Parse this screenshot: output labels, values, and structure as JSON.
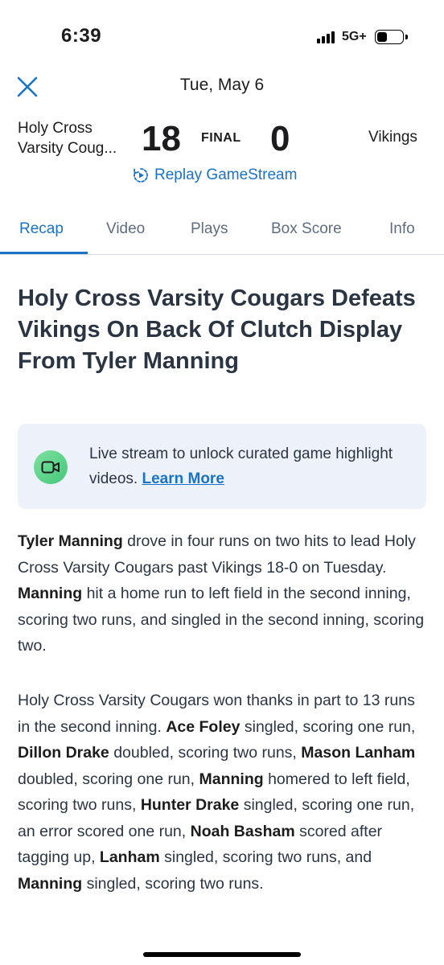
{
  "status_bar": {
    "time": "6:39",
    "network": "5G+"
  },
  "header": {
    "date": "Tue, May 6"
  },
  "game": {
    "home_team_line1": "Holy Cross",
    "home_team_line2": "Varsity Coug...",
    "home_score": "18",
    "status": "FINAL",
    "away_score": "0",
    "away_team": "Vikings",
    "replay_label": "Replay GameStream"
  },
  "tabs": [
    {
      "label": "Recap",
      "active": true
    },
    {
      "label": "Video",
      "active": false
    },
    {
      "label": "Plays",
      "active": false
    },
    {
      "label": "Box Score",
      "active": false
    },
    {
      "label": "Info",
      "active": false
    }
  ],
  "article": {
    "headline": "Holy Cross Varsity Cougars Defeats Vikings On Back Of Clutch Display From Tyler Manning",
    "promo_text": "Live stream to unlock curated game highlight videos.",
    "promo_link": "Learn More",
    "paragraph1": [
      {
        "text": "Tyler Manning",
        "bold": true
      },
      {
        "text": " drove in four runs on two hits to lead Holy Cross Varsity Cougars past Vikings 18-0 on Tuesday. ",
        "bold": false
      },
      {
        "text": "Manning",
        "bold": true
      },
      {
        "text": " hit a home run to left field in the second inning, scoring two runs, and singled in the second inning, scoring two.",
        "bold": false
      }
    ],
    "paragraph2": [
      {
        "text": "Holy Cross Varsity Cougars won thanks in part to 13 runs in the second inning.  ",
        "bold": false
      },
      {
        "text": "Ace  Foley",
        "bold": true
      },
      {
        "text": " singled, scoring one run, ",
        "bold": false
      },
      {
        "text": "Dillon Drake",
        "bold": true
      },
      {
        "text": " doubled, scoring two runs, ",
        "bold": false
      },
      {
        "text": "Mason Lanham",
        "bold": true
      },
      {
        "text": " doubled, scoring one run, ",
        "bold": false
      },
      {
        "text": "Manning",
        "bold": true
      },
      {
        "text": " homered to left field, scoring two runs, ",
        "bold": false
      },
      {
        "text": "Hunter Drake",
        "bold": true
      },
      {
        "text": " singled, scoring one run, an error scored one run, ",
        "bold": false
      },
      {
        "text": "Noah Basham",
        "bold": true
      },
      {
        "text": " scored after tagging up, ",
        "bold": false
      },
      {
        "text": "Lanham",
        "bold": true
      },
      {
        "text": " singled, scoring two runs, and ",
        "bold": false
      },
      {
        "text": "Manning",
        "bold": true
      },
      {
        "text": " singled, scoring two runs.",
        "bold": false
      }
    ]
  },
  "colors": {
    "accent": "#1a73c6",
    "promo_bg": "#edf2fa",
    "text": "#2b3542"
  }
}
